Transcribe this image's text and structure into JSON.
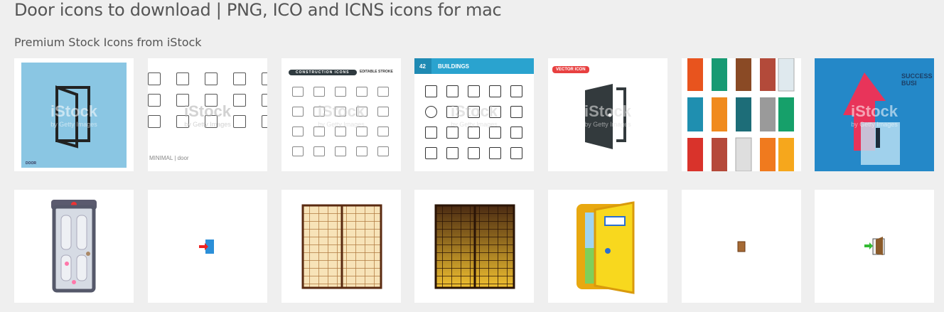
{
  "page": {
    "title": "Door icons to download | PNG, ICO and ICNS icons for mac",
    "section": "Premium Stock Icons from iStock"
  },
  "watermark": {
    "brand": "iStock",
    "sub": "by Getty Images"
  },
  "stock_tiles": [
    {
      "name": "door-outline-blue",
      "caption": "DOOR"
    },
    {
      "name": "door-minimal-set",
      "caption": "MINIMAL | door"
    },
    {
      "name": "construction-icons",
      "badge": "CONSTRUCTION ICONS",
      "badge2": "EDITABLE STROKE"
    },
    {
      "name": "buildings-icons",
      "count": "42",
      "badge": "BUILDINGS"
    },
    {
      "name": "vector-door",
      "badge": "VECTOR ICON"
    },
    {
      "name": "colored-doors"
    },
    {
      "name": "success-business",
      "caption": "SUCCESS BUSI"
    }
  ],
  "icon_tiles": [
    "cartoon-door",
    "exit-door-small",
    "shoji-door-light",
    "shoji-door-dark",
    "yellow-open-door",
    "wooden-door-small",
    "exit-door-green-arrow"
  ],
  "colors": {
    "background": "#efefef",
    "tile": "#ffffff",
    "blue": "#8ac6e3",
    "buildings": "#2aa3cf",
    "vector_badge": "#e84040"
  }
}
